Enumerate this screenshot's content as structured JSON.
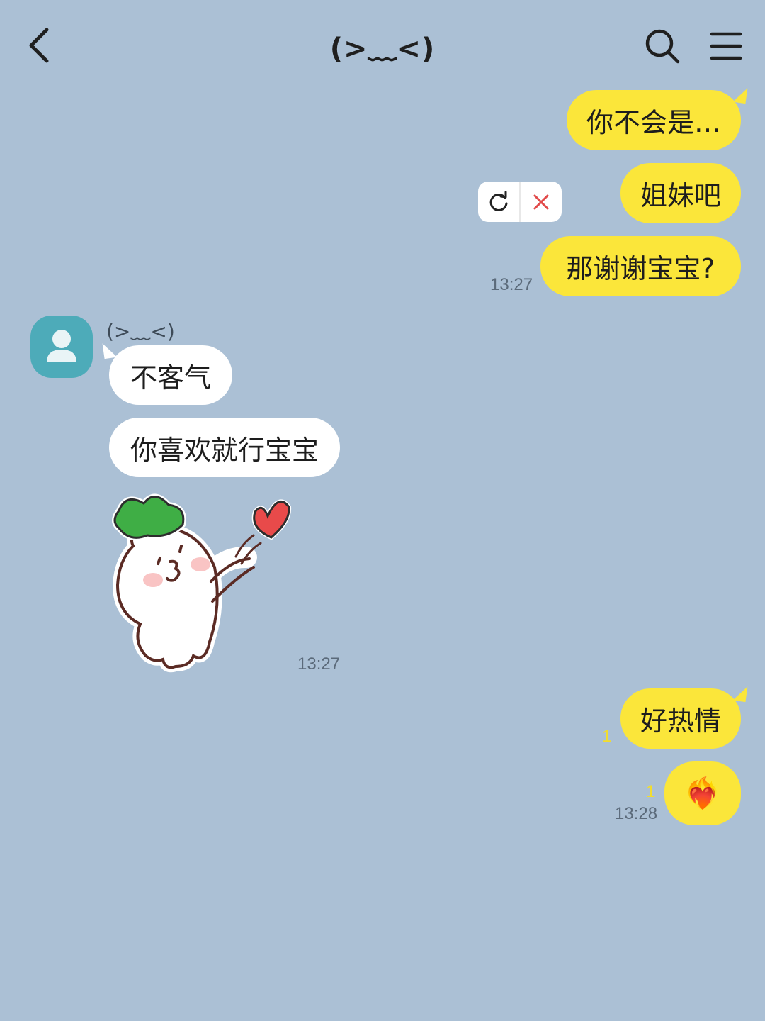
{
  "header": {
    "title": "(>﹏<)",
    "back_icon": "chevron-left-icon",
    "search_icon": "search-icon",
    "menu_icon": "hamburger-menu-icon"
  },
  "messages_out_1": {
    "m1": "你不会是…",
    "m2": "姐妹吧",
    "m3": "那谢谢宝宝?",
    "time": "13:27"
  },
  "failed_controls": {
    "retry_icon": "refresh-icon",
    "cancel_icon": "close-icon"
  },
  "incoming": {
    "sender": "(>﹏<)",
    "avatar_icon": "person-icon",
    "m1": "不客气",
    "m2": "你喜欢就行宝宝",
    "sticker": "radish-blowing-kiss-heart-sticker",
    "time": "13:27"
  },
  "messages_out_2": {
    "m1": "好热情",
    "m1_unread": "1",
    "m2": "❤️‍🔥",
    "m2_unread": "1",
    "time": "13:28"
  },
  "colors": {
    "background": "#abc0d5",
    "outgoing_bubble": "#fbe63a",
    "incoming_bubble": "#ffffff",
    "avatar": "#4dabb9"
  }
}
